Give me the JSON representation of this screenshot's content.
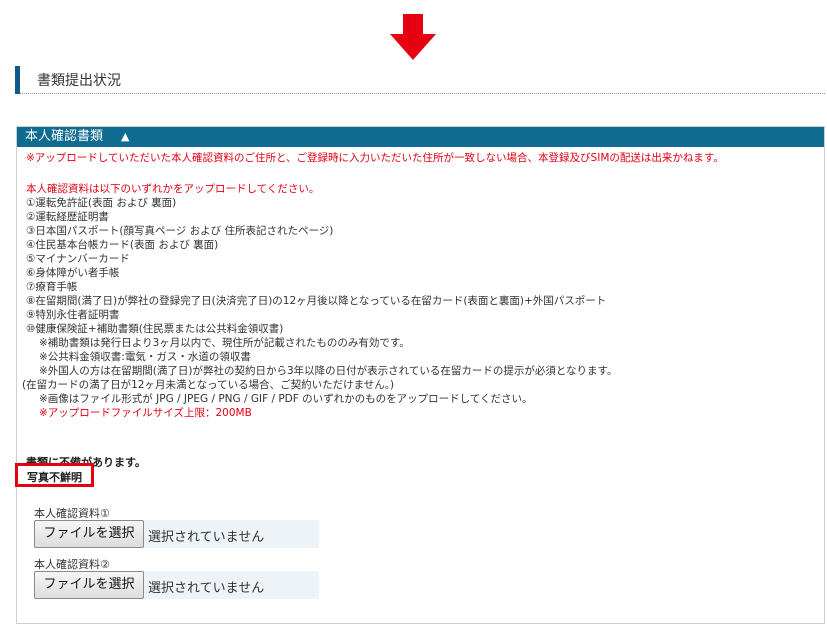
{
  "colors": {
    "accent": "#0f6b8f",
    "arrow": "#e60012",
    "alert": "#e60012"
  },
  "icons": {
    "arrow": "down-arrow-icon"
  },
  "section": {
    "title": "書類提出状況"
  },
  "panel": {
    "title": "本人確認書類",
    "toggle_symbol": "▲",
    "notice": "※アップロードしていただいた本人確認資料のご住所と、ご登録時に入力いただいた住所が一致しない場合、本登録及びSIMの配送は出来かねます。",
    "intro": "本人確認資料は以下のいずれかをアップロードしてください。",
    "doc_items": [
      "①運転免許証(表面 および 裏面)",
      "②運転経歴証明書",
      "③日本国パスポート(顔写真ページ および 住所表記されたページ)",
      "④住民基本台帳カード(表面 および 裏面)",
      "⑤マイナンバーカード",
      "⑥身体障がい者手帳",
      "⑦療育手帳",
      "⑧在留期間(満了日)が弊社の登録完了日(決済完了日)の12ヶ月後以降となっている在留カード(表面と裏面)+外国パスポート",
      "⑨特別永住者証明書",
      "⑩健康保険証+補助書類(住民票または公共料金領収書)"
    ],
    "notes": [
      "※補助書類は発行日より3ヶ月以内で、現住所が記載されたもののみ有効です。",
      "※公共料金領収書:電気・ガス・水道の領収書",
      "※外国人の方は在留期間(満了日)が弊社の契約日から3年以降の日付が表示されている在留カードの提示が必須となります。"
    ],
    "residence_note": "(在留カードの満了日が12ヶ月未満となっている場合、ご契約いただけません。)",
    "format_note": "※画像はファイル形式が JPG / JPEG / PNG / GIF / PDF のいずれかのものをアップロードしてください。",
    "size_note": "※アップロードファイルサイズ上限：200MB",
    "warning": "書類に不備があります。",
    "status_badge": "写真不鮮明",
    "uploads": [
      {
        "label": "本人確認資料①",
        "button": "ファイルを選択",
        "status": "選択されていません"
      },
      {
        "label": "本人確認資料②",
        "button": "ファイルを選択",
        "status": "選択されていません"
      }
    ]
  }
}
